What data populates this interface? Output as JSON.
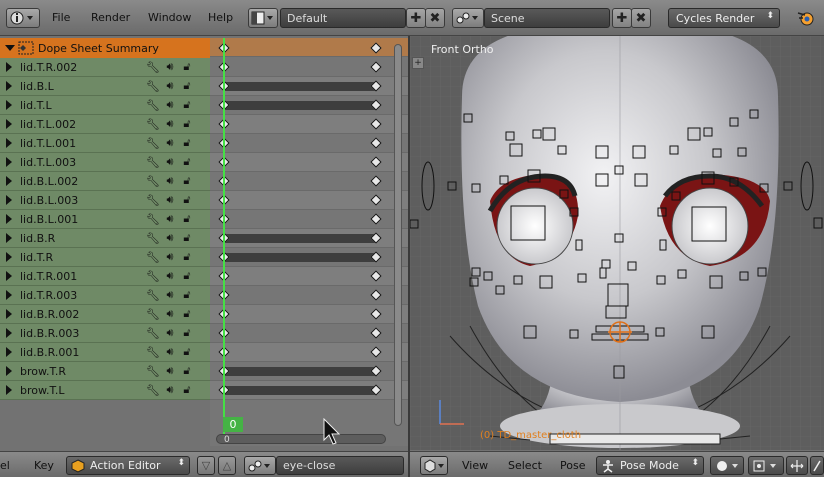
{
  "topbar": {
    "menu": [
      "File",
      "Render",
      "Window",
      "Help"
    ],
    "layout_name": "Default",
    "scene_name": "Scene",
    "render_engine": "Cycles Render"
  },
  "dopesheet": {
    "summary_label": "Dope Sheet Summary",
    "channels": [
      {
        "name": "lid.T.R.002",
        "hold": false
      },
      {
        "name": "lid.B.L",
        "hold": true
      },
      {
        "name": "lid.T.L",
        "hold": true
      },
      {
        "name": "lid.T.L.002",
        "hold": false
      },
      {
        "name": "lid.T.L.001",
        "hold": false
      },
      {
        "name": "lid.T.L.003",
        "hold": false
      },
      {
        "name": "lid.B.L.002",
        "hold": false
      },
      {
        "name": "lid.B.L.003",
        "hold": false
      },
      {
        "name": "lid.B.L.001",
        "hold": false
      },
      {
        "name": "lid.B.R",
        "hold": true
      },
      {
        "name": "lid.T.R",
        "hold": true
      },
      {
        "name": "lid.T.R.001",
        "hold": false
      },
      {
        "name": "lid.T.R.003",
        "hold": false
      },
      {
        "name": "lid.B.R.002",
        "hold": false
      },
      {
        "name": "lid.B.R.003",
        "hold": false
      },
      {
        "name": "lid.B.R.001",
        "hold": false
      },
      {
        "name": "brow.T.R",
        "hold": true
      },
      {
        "name": "brow.T.L",
        "hold": true
      }
    ],
    "current_frame": "0",
    "scroll_frame": "0"
  },
  "bottom_left": {
    "menu_partial": "el",
    "key_menu": "Key",
    "mode": "Action Editor",
    "action_name": "eye-close"
  },
  "viewport": {
    "view_label": "Front Ortho",
    "object_label": "(0) TD_master_cloth",
    "menu": [
      "View",
      "Select",
      "Pose"
    ],
    "mode": "Pose Mode"
  }
}
